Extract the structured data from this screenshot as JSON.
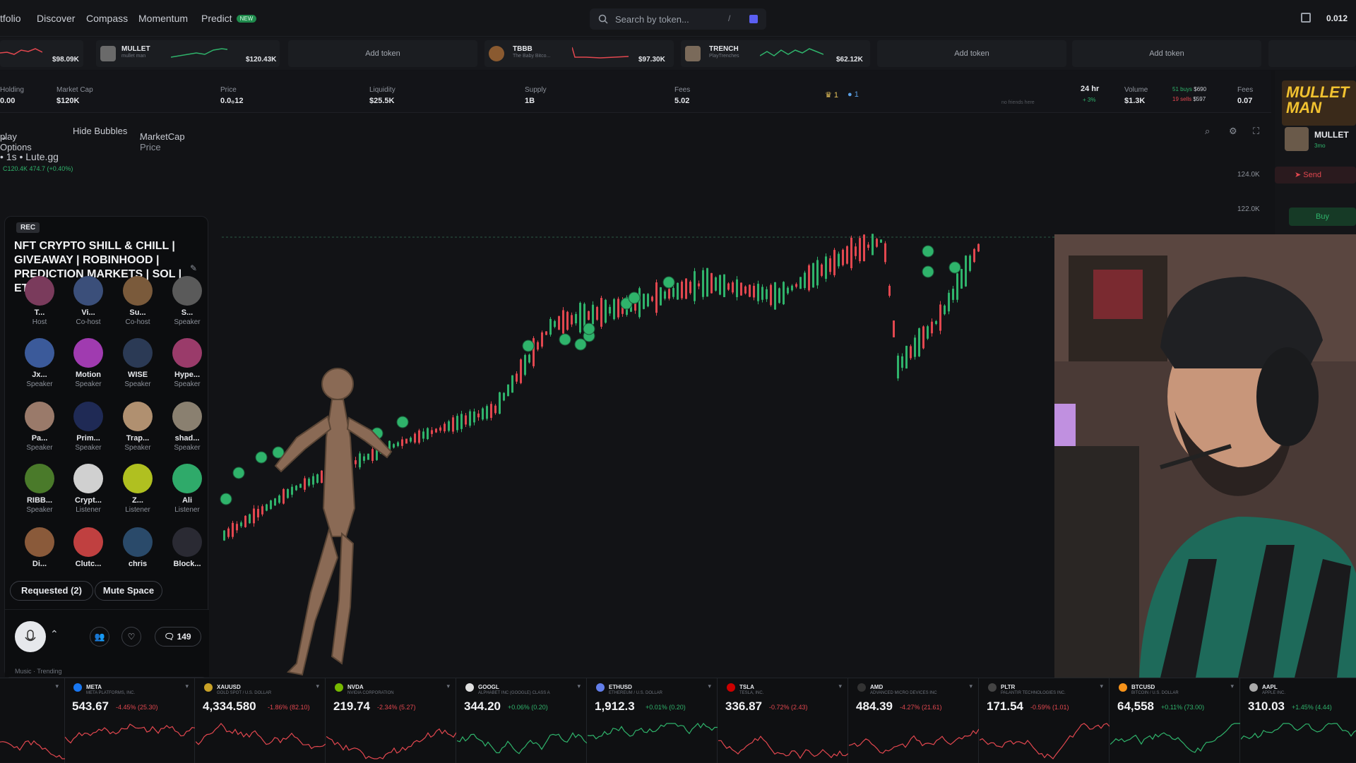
{
  "nav": {
    "items": [
      "tfolio",
      "Discover",
      "Compass",
      "Momentum",
      "Predict"
    ],
    "new_badge": "NEW",
    "search_placeholder": "Search by token...",
    "search_shortcut": "/",
    "wallet_value": "0.012"
  },
  "tickers": [
    {
      "value": "$98.09K"
    },
    {
      "name": "MULLET",
      "sub": "mullet man",
      "value": "$120.43K"
    },
    {
      "add": "Add token"
    },
    {
      "name": "TBBB",
      "sub": "The Baby Bitco...",
      "value": "$97.30K"
    },
    {
      "name": "TRENCH",
      "sub": "PlayTrenches",
      "value": "$62.12K"
    },
    {
      "add": "Add token"
    },
    {
      "add": "Add token"
    }
  ],
  "stats": {
    "holding": {
      "label": "Holding",
      "value": "0.00"
    },
    "marketcap": {
      "label": "Market Cap",
      "value": "$120K"
    },
    "price": {
      "label": "Price",
      "value": "0.0₀12"
    },
    "liquidity": {
      "label": "Liquidity",
      "value": "$25.5K"
    },
    "supply": {
      "label": "Supply",
      "value": "1B"
    },
    "fees": {
      "label": "Fees",
      "value": "5.02"
    },
    "crowns": "1",
    "drops": "1",
    "friends": "no friends here",
    "period": "24 hr",
    "period_change": "+ 3%",
    "volume": {
      "label": "Volume",
      "value": "$1.3K"
    },
    "buys": "51 buys",
    "buys_val": "$690",
    "sells": "19 sells",
    "sells_val": "$597",
    "fees2": {
      "label": "Fees",
      "value": "0.07"
    }
  },
  "display": {
    "options": "play Options",
    "hide_bubbles": "Hide Bubbles",
    "marketcap": "MarketCap",
    "price": "/ Price",
    "series_title": "• 1s • Lute.gg",
    "series_sub": "C120.4K 474.7 (+0.40%)"
  },
  "axis": {
    "y1": "124.0K",
    "y2": "122.0K"
  },
  "right": {
    "token": "MULLET",
    "age": "3mo",
    "send": "Send",
    "buy": "Buy",
    "banner": "MULLET MAN"
  },
  "spaces": {
    "rec": "REC",
    "title": "NFT CRYPTO SHILL & CHILL | GIVEAWAY | ROBINHOOD | PREDICTION MARKETS | SOL | ETH",
    "speakers": [
      {
        "name": "T...",
        "role": "Host",
        "color": "#7a3b5c"
      },
      {
        "name": "Vi...",
        "role": "Co-host",
        "color": "#3b4f7a"
      },
      {
        "name": "Su...",
        "role": "Co-host",
        "color": "#7a5a3b"
      },
      {
        "name": "S...",
        "role": "Speaker",
        "color": "#5a5a5a"
      },
      {
        "name": "Jx...",
        "role": "Speaker",
        "color": "#3b5a9a"
      },
      {
        "name": "Motion",
        "role": "Speaker",
        "color": "#a03bb0"
      },
      {
        "name": "WISE",
        "role": "Speaker",
        "color": "#2b3a55"
      },
      {
        "name": "Hype...",
        "role": "Speaker",
        "color": "#9a3b6a"
      },
      {
        "name": "Pa...",
        "role": "Speaker",
        "color": "#9a7a6a"
      },
      {
        "name": "Prim...",
        "role": "Speaker",
        "color": "#1f2a55"
      },
      {
        "name": "Trap...",
        "role": "Speaker",
        "color": "#b09070"
      },
      {
        "name": "shad...",
        "role": "Speaker",
        "color": "#8a8070"
      },
      {
        "name": "RIBB...",
        "role": "Speaker",
        "color": "#4a7a2a"
      },
      {
        "name": "Crypt...",
        "role": "Listener",
        "color": "#d0d0d0"
      },
      {
        "name": "Z...",
        "role": "Listener",
        "color": "#b0c020"
      },
      {
        "name": "Ali",
        "role": "Listener",
        "color": "#2faa6a"
      },
      {
        "name": "Di...",
        "role": "",
        "color": "#8a5a3a"
      },
      {
        "name": "Clutc...",
        "role": "",
        "color": "#c04040"
      },
      {
        "name": "chris",
        "role": "",
        "color": "#2a4a6a"
      },
      {
        "name": "Block...",
        "role": "",
        "color": "#2a2a33"
      }
    ],
    "requested": "Requested (2)",
    "mute": "Mute Space",
    "comments": "149",
    "music": "Music · Trending"
  },
  "bottom": [
    {
      "sym": "",
      "sub": "",
      "price": "",
      "change": "66% (50.90)",
      "up": false,
      "color": "#555"
    },
    {
      "sym": "META",
      "sub": "META PLATFORMS, INC.",
      "price": "543.67",
      "change": "-4.45% (25.30)",
      "up": false,
      "color": "#1877f2"
    },
    {
      "sym": "XAUUSD",
      "sub": "GOLD SPOT / U.S. DOLLAR",
      "price": "4,334.580",
      "change": "-1.86% (82.10)",
      "up": false,
      "color": "#c9a227"
    },
    {
      "sym": "NVDA",
      "sub": "NVIDIA CORPORATION",
      "price": "219.74",
      "change": "-2.34% (5.27)",
      "up": false,
      "color": "#76b900"
    },
    {
      "sym": "GOOGL",
      "sub": "ALPHABET INC (GOOGLE) CLASS A",
      "price": "344.20",
      "change": "+0.06% (0.20)",
      "up": true,
      "color": "#e0e0e0"
    },
    {
      "sym": "ETHUSD",
      "sub": "ETHEREUM / U.S. DOLLAR",
      "price": "1,912.3",
      "change": "+0.01% (0.20)",
      "up": true,
      "color": "#627eea"
    },
    {
      "sym": "TSLA",
      "sub": "TESLA, INC.",
      "price": "336.87",
      "change": "-0.72% (2.43)",
      "up": false,
      "color": "#cc0000"
    },
    {
      "sym": "AMD",
      "sub": "ADVANCED MICRO DEVICES INC",
      "price": "484.39",
      "change": "-4.27% (21.61)",
      "up": false,
      "color": "#333"
    },
    {
      "sym": "PLTR",
      "sub": "PALANTIR TECHNOLOGIES INC.",
      "price": "171.54",
      "change": "-0.59% (1.01)",
      "up": false,
      "color": "#444"
    },
    {
      "sym": "BTCUSD",
      "sub": "BITCOIN / U.S. DOLLAR",
      "price": "64,558",
      "change": "+0.11% (73.00)",
      "up": true,
      "color": "#f7931a"
    },
    {
      "sym": "AAPL",
      "sub": "APPLE INC.",
      "price": "310.03",
      "change": "+1.45% (4.44)",
      "up": true,
      "color": "#aaa"
    }
  ]
}
